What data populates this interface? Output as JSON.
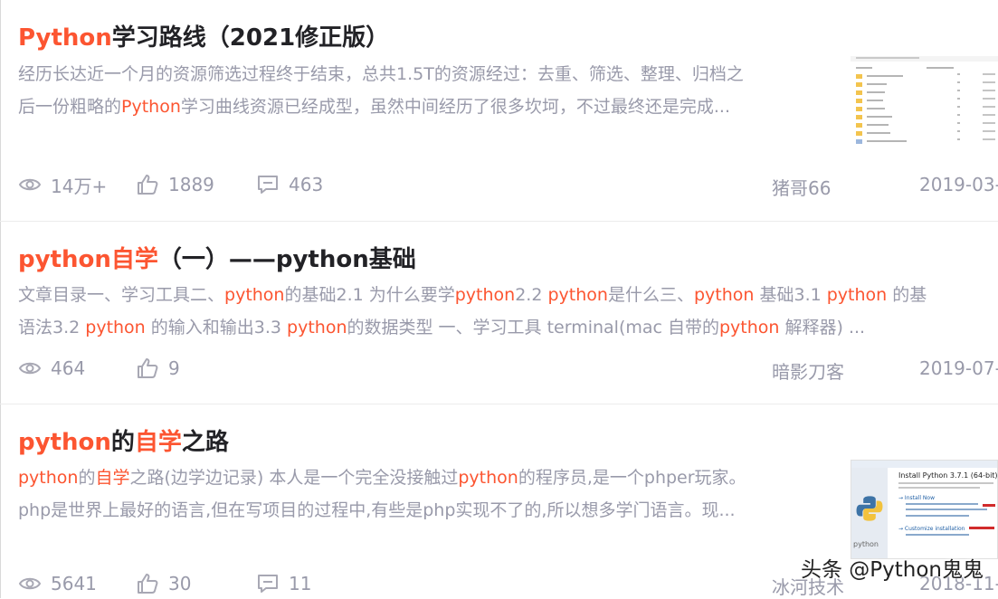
{
  "articles": [
    {
      "title": {
        "hl": "Python",
        "rest": "学习路线（2021修正版）"
      },
      "summary_line1": "经历长达近一个月的资源筛选过程终于结束，总共1.5T的资源经过：去重、筛选、整理、归档之",
      "summary_line2_pre": "后一份粗略的",
      "summary_line2_hl": "Python",
      "summary_line2_post": "学习曲线资源已经成型，虽然中间经历了很多坎坷，不过最终还是完成...",
      "views": "14万+",
      "likes": "1889",
      "comments": "463",
      "author": "猪哥66",
      "date": "2019-03-"
    },
    {
      "title": {
        "hl": "python自学",
        "rest": "（一）——python基础"
      },
      "summary_line1_parts": [
        "文章目录一、学习工具二、",
        "python",
        "的基础2.1 为什么要学",
        "python",
        "2.2 ",
        "python",
        "是什么三、",
        "python",
        " 基础3.1 ",
        "python",
        " 的基"
      ],
      "summary_line2_parts": [
        "语法3.2 ",
        "python",
        " 的输入和输出3.3 ",
        "python",
        "的数据类型 一、学习工具 terminal(mac 自带的",
        "python",
        " 解释器) ..."
      ],
      "views": "464",
      "likes": "9",
      "author": "暗影刀客",
      "date": "2019-07-"
    },
    {
      "title": {
        "hl1": "python",
        "mid": "的",
        "hl2": "自学",
        "rest": "之路"
      },
      "summary_line1_parts": [
        "python",
        "的",
        "自学",
        "之路(边学边记录) 本人是一个完全没接触过",
        "python",
        "的程序员,是一个phper玩家。"
      ],
      "summary_line2": "php是世界上最好的语言,但在写项目的过程中,有些是php实现不了的,所以想多学门语言。现...",
      "views": "5641",
      "likes": "30",
      "comments": "11",
      "author": "冰河技术",
      "date": "2018-11-"
    }
  ],
  "thumb2": {
    "title": "Install Python 3.7.1 (64-bit)",
    "install_now": "→ Install Now",
    "customize": "→ Customize installation",
    "logo_text": "python"
  },
  "watermark": "头条 @Python鬼鬼",
  "colors": {
    "highlight": "#fc5531",
    "title": "#222226",
    "meta": "#999aaa"
  },
  "icons": [
    "eye-icon",
    "thumb-up-icon",
    "comment-icon",
    "folder-icon",
    "python-logo-icon"
  ]
}
